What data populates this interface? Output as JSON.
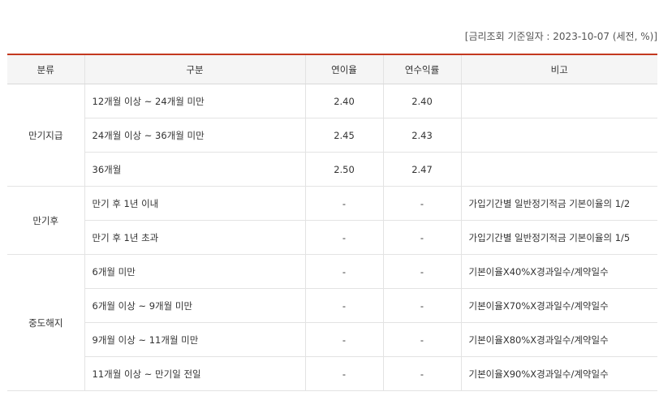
{
  "ref_date": "[금리조회 기준일자 : 2023-10-07 (세전, %)]",
  "headers": {
    "category": "분류",
    "division": "구분",
    "annual_rate": "연이율",
    "annual_yield": "연수익률",
    "remarks": "비고"
  },
  "groups": [
    {
      "name": "만기지급",
      "rows": [
        {
          "division": "12개월 이상 ~ 24개월 미만",
          "annual_rate": "2.40",
          "annual_yield": "2.40",
          "remarks": ""
        },
        {
          "division": "24개월 이상 ~ 36개월 미만",
          "annual_rate": "2.45",
          "annual_yield": "2.43",
          "remarks": ""
        },
        {
          "division": "36개월",
          "annual_rate": "2.50",
          "annual_yield": "2.47",
          "remarks": ""
        }
      ]
    },
    {
      "name": "만기후",
      "rows": [
        {
          "division": "만기 후 1년 이내",
          "annual_rate": "-",
          "annual_yield": "-",
          "remarks": "가입기간별 일반정기적금 기본이율의 1/2"
        },
        {
          "division": "만기 후 1년 초과",
          "annual_rate": "-",
          "annual_yield": "-",
          "remarks": "가입기간별 일반정기적금 기본이율의 1/5"
        }
      ]
    },
    {
      "name": "중도해지",
      "rows": [
        {
          "division": "6개월 미만",
          "annual_rate": "-",
          "annual_yield": "-",
          "remarks": "기본이율X40%X경과일수/계약일수"
        },
        {
          "division": "6개월 이상 ~ 9개월 미만",
          "annual_rate": "-",
          "annual_yield": "-",
          "remarks": "기본이율X70%X경과일수/계약일수"
        },
        {
          "division": "9개월 이상 ~ 11개월 미만",
          "annual_rate": "-",
          "annual_yield": "-",
          "remarks": "기본이율X80%X경과일수/계약일수"
        },
        {
          "division": "11개월 이상 ~ 만기일 전일",
          "annual_rate": "-",
          "annual_yield": "-",
          "remarks": "기본이율X90%X경과일수/계약일수"
        }
      ]
    }
  ],
  "colors": {
    "header_top_border": "#c3381f",
    "header_background": "#f5f5f5",
    "grid_line": "#e3e3e3"
  }
}
